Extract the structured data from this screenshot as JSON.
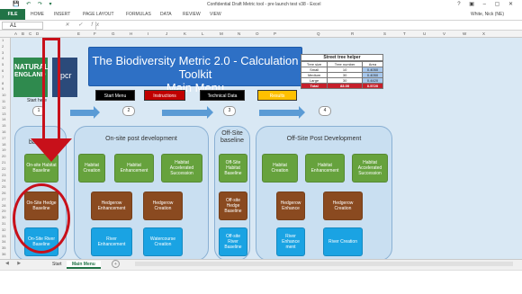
{
  "titlebar": {
    "title": "Confidential Draft Metric tool - pre launch test v38 - Excel",
    "quick_access": "💾 ↶ ↷ ▾",
    "window_controls": "? ▣ – ▢ ✕"
  },
  "ribbon": {
    "file": "FILE",
    "tabs": [
      "HOME",
      "INSERT",
      "PAGE LAYOUT",
      "FORMULAS",
      "DATA",
      "REVIEW",
      "VIEW"
    ],
    "user": "White, Nick (NE)"
  },
  "formula_bar": {
    "name_box": "A1",
    "fx_symbols": "✕ ✓ fx"
  },
  "columns": [
    "A",
    "B",
    "C",
    "D",
    "E",
    "F",
    "G",
    "H",
    "I",
    "J",
    "K",
    "L",
    "M",
    "N",
    "O",
    "P",
    "Q",
    "R",
    "S",
    "T",
    "U",
    "V",
    "W",
    "X"
  ],
  "rows": [
    "1",
    "2",
    "3",
    "4",
    "5",
    "6",
    "7",
    "8",
    "9",
    "10",
    "11",
    "12",
    "13",
    "14",
    "15",
    "16",
    "17",
    "18",
    "19",
    "20",
    "21",
    "22",
    "23",
    "24",
    "25",
    "26",
    "27",
    "28",
    "29",
    "30",
    "31",
    "32",
    "33",
    "34",
    "35",
    "36"
  ],
  "logos": {
    "ne_line1": "NATURAL",
    "ne_line2": "ENGLAND",
    "fpcr": "fpcr"
  },
  "main_title": {
    "line1": "The Biodiversity Metric 2.0 - Calculation Toolkit",
    "line2": "Main  Menu"
  },
  "tree_helper": {
    "title": "Street tree helper",
    "headers": [
      "Tree size",
      "Tree number",
      "Area"
    ],
    "rows": [
      [
        "Small",
        "10",
        "0.4050"
      ],
      [
        "Medium",
        "30",
        "0.4050"
      ],
      [
        "Large",
        "30",
        "0.4420"
      ]
    ],
    "total": [
      "Total",
      "83.00",
      "0.5720"
    ]
  },
  "start_here": "Start here",
  "nav_buttons": {
    "start_menu": "Start Menu",
    "instructions": "Instructions",
    "technical_data": "Technical Data",
    "results": "Results"
  },
  "step_numbers": [
    "1",
    "2",
    "3",
    "4"
  ],
  "panels": {
    "onsite_baseline": "baseline",
    "onsite_post": "On-site post development",
    "offsite_baseline": "Off-Site baseline",
    "offsite_post": "Off-Site Post Development"
  },
  "tiles": {
    "onsite_habitat_baseline": "On-site Habitat Baseline",
    "onsite_hedge_baseline": "On-Site Hedge Baseline",
    "onsite_river_baseline": "On-Site River Baseline",
    "habitat_creation": "Habitat Creation",
    "habitat_enhancement": "Habitat Enhancement",
    "habitat_accelerated": "Habitat Accelerated Succession",
    "hedgerow_enhancement": "Hedgerow Enhancement",
    "hedgerow_creation": "Hedgerow Creation",
    "river_enhancement": "River Enhancement",
    "watercourse_creation": "Watercourse Creation",
    "offsite_habitat_baseline": "Off-Site Habitat Baseline",
    "offsite_hedge_baseline": "Off-site Hedge Baseline",
    "offsite_river_baseline": "Off-site River Baseline",
    "off_habitat_creation": "Habitat Creation",
    "off_habitat_enhancement": "Habitat Enhancement",
    "off_habitat_accelerated": "Habitat Accelerated Succession",
    "off_hedgerow_enhance": "Hedgerow Enhance",
    "off_hedgerow_creation": "Hedgerow Creation",
    "off_river_enhancement": "River Enhance ment",
    "off_river_creation": "River Creation"
  },
  "sheet_tabs": {
    "nav": "◀ ▶",
    "tabs": [
      "Start",
      "Main Menu"
    ],
    "add": "+"
  },
  "colors": {
    "excel_green": "#217346",
    "title_blue": "#2e70c5",
    "tile_green": "#66a23d",
    "tile_brown": "#8a4a20",
    "tile_blue": "#1aa3e3",
    "highlight_red": "#c8101a"
  }
}
